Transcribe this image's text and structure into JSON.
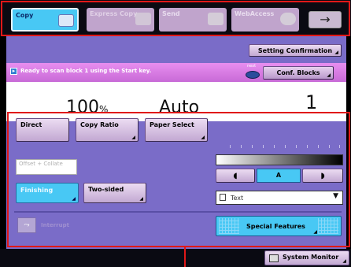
{
  "tabs": [
    {
      "label": "Copy",
      "state": "active"
    },
    {
      "label": "Express Copy",
      "state": "disabled"
    },
    {
      "label": "Send",
      "state": "inactive"
    },
    {
      "label": "WebAccess",
      "state": "inactive"
    }
  ],
  "tab_arrow_glyph": "→",
  "setting_confirmation_label": "Setting Confirmation",
  "status": {
    "message": "Ready to scan block 1 using the Start key.",
    "copies_icon_label": "next",
    "conf_blocks_label": "Conf. Blocks"
  },
  "readout": {
    "ratio_value": "100",
    "ratio_unit": "%",
    "paper": "Auto",
    "copies": "1"
  },
  "settings": {
    "direct_label": "Direct",
    "copy_ratio_label": "Copy Ratio",
    "paper_select_label": "Paper Select",
    "offset_collate_label": "Offset + Collate",
    "finishing_label": "Finishing",
    "two_sided_label": "Two-sided"
  },
  "density": {
    "lighter_glyph": "◖",
    "auto_label": "A",
    "darker_glyph": "◗",
    "level_selected": "auto"
  },
  "image_type": {
    "selected": "Text",
    "caret_glyph": "▼"
  },
  "bottom": {
    "interrupt_label": "Interrupt",
    "special_features_label": "Special Features",
    "system_monitor_label": "System Monitor"
  },
  "colors": {
    "panel": "#7a6cc8",
    "active_accent": "#48c8f4",
    "status_bar": "#d87ee4",
    "highlight_outline": "#e01818"
  },
  "icons": {
    "copy_tab": "copier-icon",
    "send_tab": "envelope-icon",
    "webaccess_tab": "globe-icon",
    "system_monitor": "monitor-icon"
  }
}
